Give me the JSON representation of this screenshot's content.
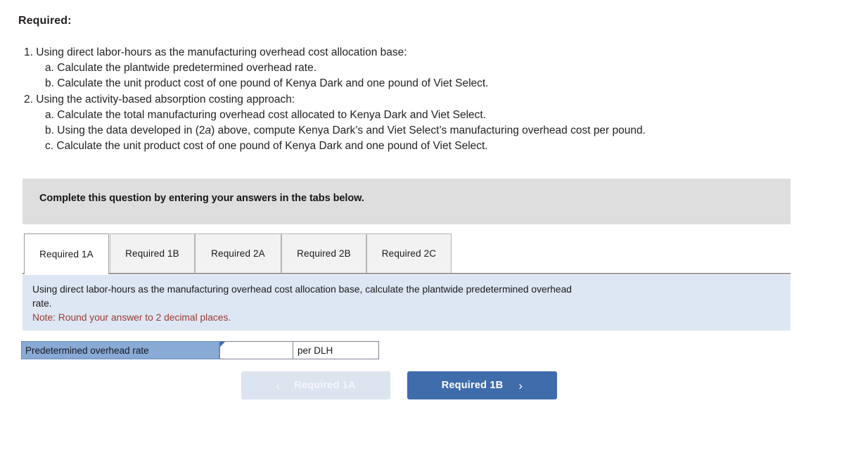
{
  "heading": "Required:",
  "requirements": [
    {
      "indent": 1,
      "prefix": "1.",
      "text": "Using direct labor-hours as the manufacturing overhead cost allocation base:"
    },
    {
      "indent": 2,
      "prefix": "a.",
      "text": "Calculate the plantwide predetermined overhead rate."
    },
    {
      "indent": 2,
      "prefix": "b.",
      "text": "Calculate the unit product cost of one pound of Kenya Dark and one pound of Viet Select."
    },
    {
      "indent": 1,
      "prefix": "2.",
      "text": "Using the activity-based absorption costing approach:"
    },
    {
      "indent": 2,
      "prefix": "a.",
      "text": "Calculate the total manufacturing overhead cost allocated to Kenya Dark and Viet Select."
    },
    {
      "indent": 2,
      "prefix": "b.",
      "text": "Using the data developed in (2a) above, compute Kenya Dark’s and Viet Select’s manufacturing overhead cost per pound.",
      "italic_segment": "a"
    },
    {
      "indent": 2,
      "prefix": "c.",
      "text": "Calculate the unit product cost of one pound of Kenya Dark and one pound of Viet Select."
    }
  ],
  "banner": {
    "text": "Complete this question by entering your answers in the tabs below."
  },
  "tabs": [
    {
      "label": "Required 1A",
      "active": true
    },
    {
      "label": "Required 1B",
      "active": false
    },
    {
      "label": "Required 2A",
      "active": false
    },
    {
      "label": "Required 2B",
      "active": false
    },
    {
      "label": "Required 2C",
      "active": false
    }
  ],
  "instruction": {
    "line1": "Using direct labor-hours as the manufacturing overhead cost allocation base, calculate the plantwide predetermined overhead",
    "line2": "rate.",
    "note": "Note: Round your answer to 2 decimal places."
  },
  "answer": {
    "label": "Predetermined overhead rate",
    "value": "",
    "placeholder": "",
    "unit": "per DLH"
  },
  "nav": {
    "prev_label": "Required 1A",
    "prev_chevron": "‹",
    "next_label": "Required 1B",
    "next_chevron": "›"
  },
  "colors": {
    "banner_bg": "#dedede",
    "instruction_bg": "#dce7f3",
    "note_text": "#9c3a32",
    "label_cell_bg": "#8aaad6",
    "next_button_bg": "#3f6cab",
    "prev_button_bg": "#dbe4ef",
    "cursor_flag": "#3a6cb3"
  }
}
